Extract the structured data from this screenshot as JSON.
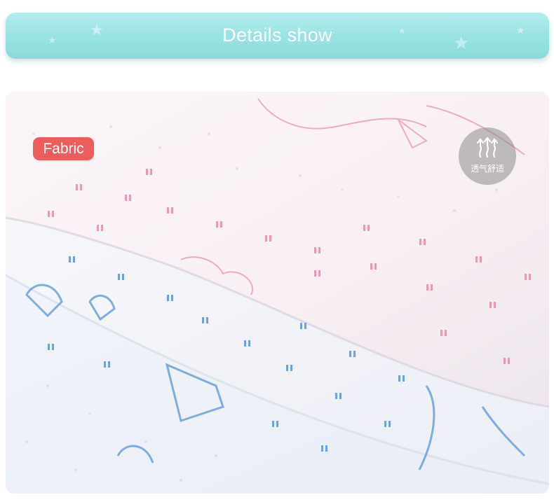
{
  "banner": {
    "title": "Details show"
  },
  "photo": {
    "badge_label": "Fabric",
    "feature_label": "透气舒适",
    "feature_icon": "breathable-arrows-icon"
  },
  "colors": {
    "banner": "#98e2e2",
    "badge": "#ee5d5d",
    "pink_dots": "#e58aa8",
    "blue_dots": "#5b93d9"
  }
}
